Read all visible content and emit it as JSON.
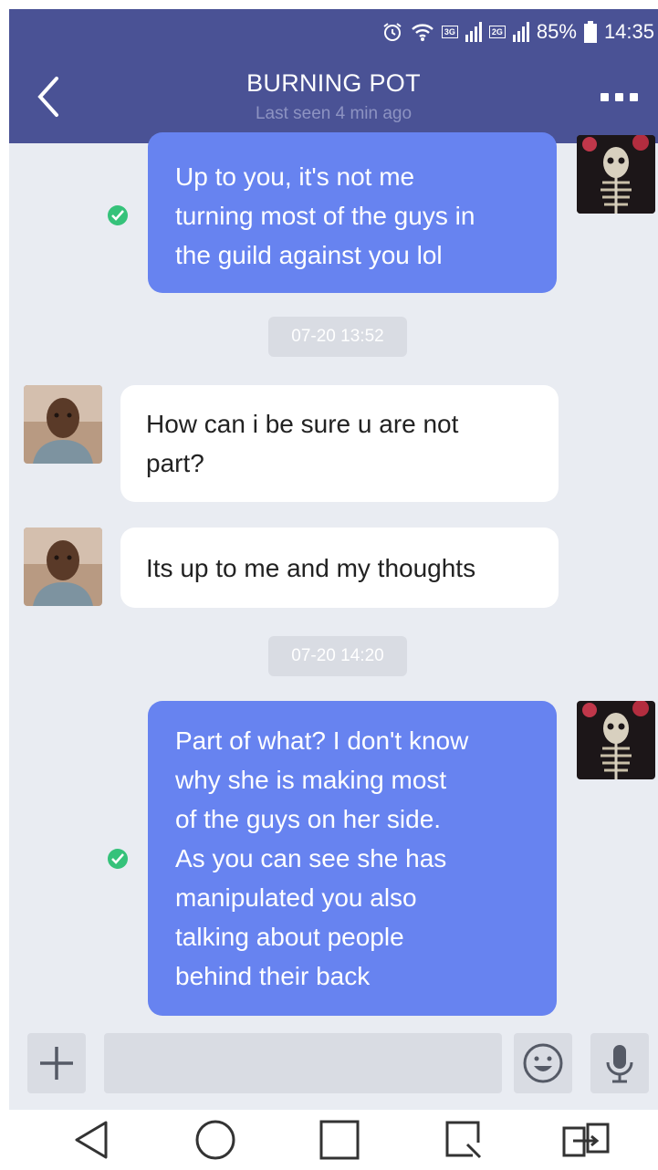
{
  "status_bar": {
    "network_1": "3G",
    "network_2": "2G",
    "battery": "85%",
    "time": "14:35"
  },
  "header": {
    "title": "BURNING POT",
    "subtitle": "Last seen 4 min ago"
  },
  "messages": [
    {
      "side": "out",
      "lines": [
        "Up to you, it's not me",
        "turning most of the guys in",
        "the guild against you lol"
      ],
      "read": true
    },
    {
      "type": "timestamp",
      "text": "07-20 13:52"
    },
    {
      "side": "in",
      "lines": [
        "How can i be sure u are not",
        "part?"
      ]
    },
    {
      "side": "in",
      "lines": [
        "Its up to me and my thoughts"
      ]
    },
    {
      "type": "timestamp",
      "text": "07-20 14:20"
    },
    {
      "side": "out",
      "lines": [
        "Part of what? I don't know",
        "why she is making most",
        "of the guys on her side.",
        "As you can see she has",
        "manipulated you also",
        "talking about people",
        "behind their back"
      ],
      "read": true
    }
  ],
  "colors": {
    "header": "#4a5295",
    "outgoing_bubble": "#6783f0",
    "incoming_bubble": "#ffffff",
    "read_check": "#35c27a",
    "background": "#e9ecf2"
  },
  "icons": {
    "header": [
      "back-arrow-icon",
      "more-options-icon"
    ],
    "input": [
      "plus-icon",
      "emoji-icon",
      "microphone-icon"
    ],
    "nav": [
      "nav-back-icon",
      "nav-home-icon",
      "nav-recent-icon",
      "nav-capture-icon",
      "nav-switch-icon"
    ]
  }
}
